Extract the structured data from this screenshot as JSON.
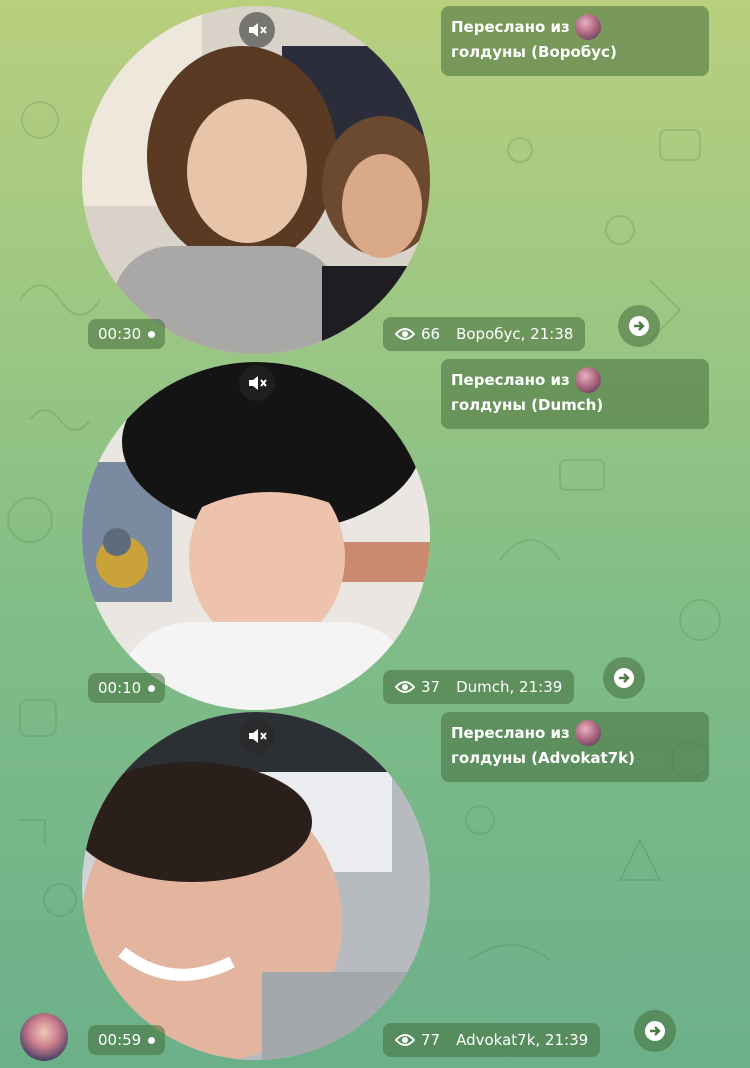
{
  "messages": [
    {
      "forward_prefix": "Переслано из",
      "forward_source": "голдуны (Воробус)",
      "duration": "00:30",
      "views": "66",
      "author_time": "Воробус, 21:38",
      "mute_icon": "speaker-muted-icon",
      "share_icon": "share-arrow-icon"
    },
    {
      "forward_prefix": "Переслано из",
      "forward_source": "голдуны (Dumch)",
      "duration": "00:10",
      "views": "37",
      "author_time": "Dumch, 21:39",
      "mute_icon": "speaker-muted-icon",
      "share_icon": "share-arrow-icon"
    },
    {
      "forward_prefix": "Переслано из",
      "forward_source": "голдуны (Advokat7k)",
      "duration": "00:59",
      "views": "77",
      "author_time": "Advokat7k, 21:39",
      "mute_icon": "speaker-muted-icon",
      "share_icon": "share-arrow-icon"
    }
  ],
  "colors": {
    "bubble": "#466e3c",
    "background_top": "#b9cf7e",
    "background_bottom": "#6cb08a"
  }
}
